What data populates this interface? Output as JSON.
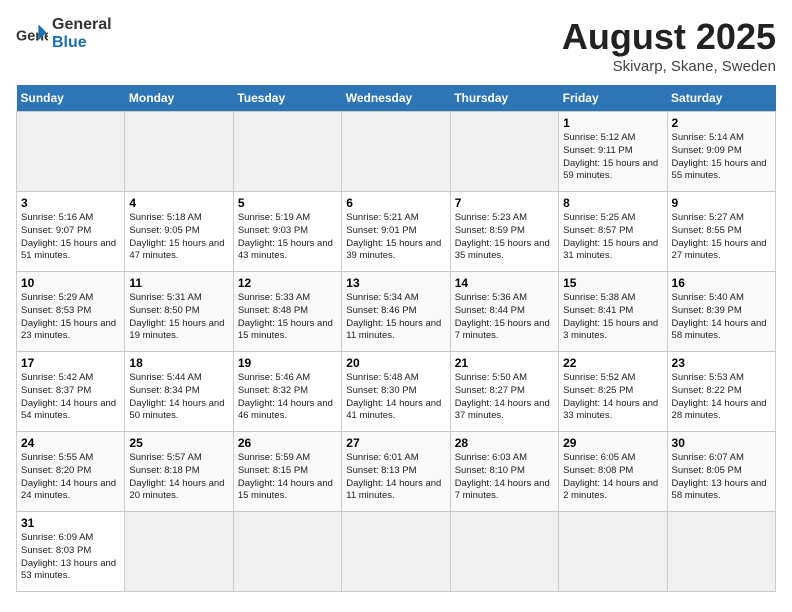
{
  "header": {
    "logo_general": "General",
    "logo_blue": "Blue",
    "title": "August 2025",
    "subtitle": "Skivarp, Skane, Sweden"
  },
  "weekdays": [
    "Sunday",
    "Monday",
    "Tuesday",
    "Wednesday",
    "Thursday",
    "Friday",
    "Saturday"
  ],
  "weeks": [
    [
      {
        "day": "",
        "info": ""
      },
      {
        "day": "",
        "info": ""
      },
      {
        "day": "",
        "info": ""
      },
      {
        "day": "",
        "info": ""
      },
      {
        "day": "",
        "info": ""
      },
      {
        "day": "1",
        "info": "Sunrise: 5:12 AM\nSunset: 9:11 PM\nDaylight: 15 hours and 59 minutes."
      },
      {
        "day": "2",
        "info": "Sunrise: 5:14 AM\nSunset: 9:09 PM\nDaylight: 15 hours and 55 minutes."
      }
    ],
    [
      {
        "day": "3",
        "info": "Sunrise: 5:16 AM\nSunset: 9:07 PM\nDaylight: 15 hours and 51 minutes."
      },
      {
        "day": "4",
        "info": "Sunrise: 5:18 AM\nSunset: 9:05 PM\nDaylight: 15 hours and 47 minutes."
      },
      {
        "day": "5",
        "info": "Sunrise: 5:19 AM\nSunset: 9:03 PM\nDaylight: 15 hours and 43 minutes."
      },
      {
        "day": "6",
        "info": "Sunrise: 5:21 AM\nSunset: 9:01 PM\nDaylight: 15 hours and 39 minutes."
      },
      {
        "day": "7",
        "info": "Sunrise: 5:23 AM\nSunset: 8:59 PM\nDaylight: 15 hours and 35 minutes."
      },
      {
        "day": "8",
        "info": "Sunrise: 5:25 AM\nSunset: 8:57 PM\nDaylight: 15 hours and 31 minutes."
      },
      {
        "day": "9",
        "info": "Sunrise: 5:27 AM\nSunset: 8:55 PM\nDaylight: 15 hours and 27 minutes."
      }
    ],
    [
      {
        "day": "10",
        "info": "Sunrise: 5:29 AM\nSunset: 8:53 PM\nDaylight: 15 hours and 23 minutes."
      },
      {
        "day": "11",
        "info": "Sunrise: 5:31 AM\nSunset: 8:50 PM\nDaylight: 15 hours and 19 minutes."
      },
      {
        "day": "12",
        "info": "Sunrise: 5:33 AM\nSunset: 8:48 PM\nDaylight: 15 hours and 15 minutes."
      },
      {
        "day": "13",
        "info": "Sunrise: 5:34 AM\nSunset: 8:46 PM\nDaylight: 15 hours and 11 minutes."
      },
      {
        "day": "14",
        "info": "Sunrise: 5:36 AM\nSunset: 8:44 PM\nDaylight: 15 hours and 7 minutes."
      },
      {
        "day": "15",
        "info": "Sunrise: 5:38 AM\nSunset: 8:41 PM\nDaylight: 15 hours and 3 minutes."
      },
      {
        "day": "16",
        "info": "Sunrise: 5:40 AM\nSunset: 8:39 PM\nDaylight: 14 hours and 58 minutes."
      }
    ],
    [
      {
        "day": "17",
        "info": "Sunrise: 5:42 AM\nSunset: 8:37 PM\nDaylight: 14 hours and 54 minutes."
      },
      {
        "day": "18",
        "info": "Sunrise: 5:44 AM\nSunset: 8:34 PM\nDaylight: 14 hours and 50 minutes."
      },
      {
        "day": "19",
        "info": "Sunrise: 5:46 AM\nSunset: 8:32 PM\nDaylight: 14 hours and 46 minutes."
      },
      {
        "day": "20",
        "info": "Sunrise: 5:48 AM\nSunset: 8:30 PM\nDaylight: 14 hours and 41 minutes."
      },
      {
        "day": "21",
        "info": "Sunrise: 5:50 AM\nSunset: 8:27 PM\nDaylight: 14 hours and 37 minutes."
      },
      {
        "day": "22",
        "info": "Sunrise: 5:52 AM\nSunset: 8:25 PM\nDaylight: 14 hours and 33 minutes."
      },
      {
        "day": "23",
        "info": "Sunrise: 5:53 AM\nSunset: 8:22 PM\nDaylight: 14 hours and 28 minutes."
      }
    ],
    [
      {
        "day": "24",
        "info": "Sunrise: 5:55 AM\nSunset: 8:20 PM\nDaylight: 14 hours and 24 minutes."
      },
      {
        "day": "25",
        "info": "Sunrise: 5:57 AM\nSunset: 8:18 PM\nDaylight: 14 hours and 20 minutes."
      },
      {
        "day": "26",
        "info": "Sunrise: 5:59 AM\nSunset: 8:15 PM\nDaylight: 14 hours and 15 minutes."
      },
      {
        "day": "27",
        "info": "Sunrise: 6:01 AM\nSunset: 8:13 PM\nDaylight: 14 hours and 11 minutes."
      },
      {
        "day": "28",
        "info": "Sunrise: 6:03 AM\nSunset: 8:10 PM\nDaylight: 14 hours and 7 minutes."
      },
      {
        "day": "29",
        "info": "Sunrise: 6:05 AM\nSunset: 8:08 PM\nDaylight: 14 hours and 2 minutes."
      },
      {
        "day": "30",
        "info": "Sunrise: 6:07 AM\nSunset: 8:05 PM\nDaylight: 13 hours and 58 minutes."
      }
    ],
    [
      {
        "day": "31",
        "info": "Sunrise: 6:09 AM\nSunset: 8:03 PM\nDaylight: 13 hours and 53 minutes."
      },
      {
        "day": "",
        "info": ""
      },
      {
        "day": "",
        "info": ""
      },
      {
        "day": "",
        "info": ""
      },
      {
        "day": "",
        "info": ""
      },
      {
        "day": "",
        "info": ""
      },
      {
        "day": "",
        "info": ""
      }
    ]
  ]
}
